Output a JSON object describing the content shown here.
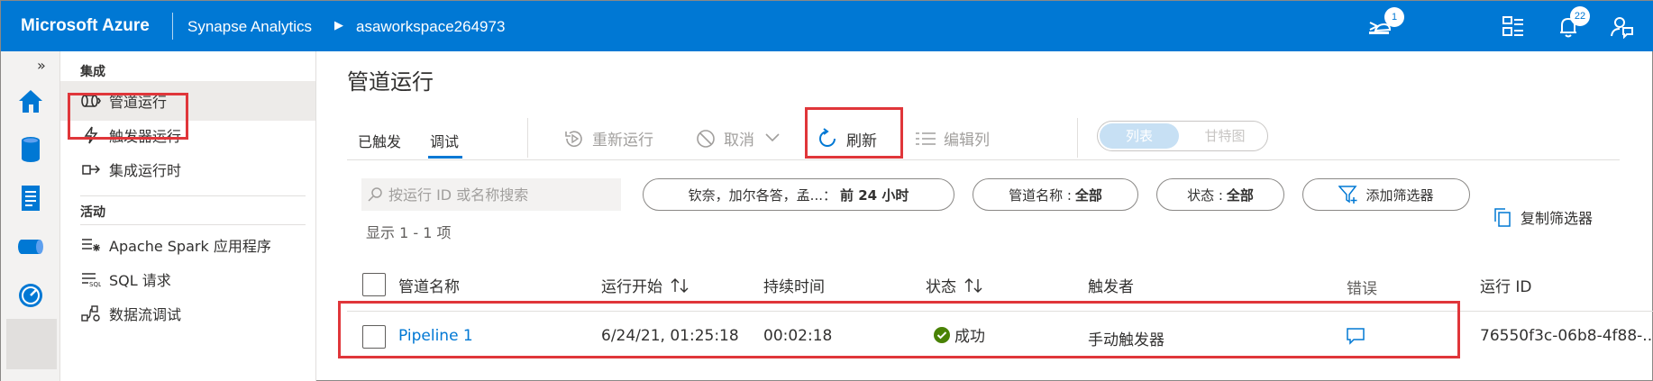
{
  "topbar": {
    "brand": "Microsoft Azure",
    "breadcrumb_service": "Synapse Analytics",
    "breadcrumb_arrow": "▶",
    "breadcrumb_workspace": "asaworkspace264973",
    "notifications_badge_1": "1",
    "notifications_badge_2": "22",
    "icons": [
      "cloud-shell-icon",
      "directory-filter-icon",
      "notifications-icon",
      "feedback-icon"
    ]
  },
  "rail": {
    "expand_glyph": "»",
    "icons": [
      "home-icon",
      "data-icon",
      "develop-icon",
      "integrate-icon",
      "monitor-icon"
    ]
  },
  "nav": {
    "section_integration": "集成",
    "items_integration": [
      {
        "label": "管道运行",
        "icon": "pipeline-runs-icon",
        "selected": true
      },
      {
        "label": "触发器运行",
        "icon": "trigger-runs-icon",
        "selected": false
      },
      {
        "label": "集成运行时",
        "icon": "integration-runtimes-icon",
        "selected": false
      }
    ],
    "section_activities": "活动",
    "items_activities": [
      {
        "label": "Apache Spark 应用程序",
        "icon": "spark-apps-icon"
      },
      {
        "label": "SQL 请求",
        "icon": "sql-requests-icon"
      },
      {
        "label": "数据流调试",
        "icon": "data-flow-debug-icon"
      }
    ]
  },
  "main": {
    "title": "管道运行",
    "tabs": [
      "已触发",
      "调试"
    ],
    "toolbar": {
      "rerun": "重新运行",
      "cancel": "取消",
      "refresh": "刷新",
      "edit_columns": "编辑列"
    },
    "view_toggle": {
      "list": "列表",
      "gantt": "甘特图",
      "selected": "列表"
    },
    "search_placeholder": "按运行 ID 或名称搜索",
    "filters": {
      "timezone": "钦奈，加尔各答，孟...",
      "time_range_sep": "：",
      "time_range": "前 24 小时",
      "pipeline_name_label": "管道名称 :",
      "pipeline_name_value": "全部",
      "status_label": "状态 :",
      "status_value": "全部",
      "add_filter": "添加筛选器",
      "copy_filter": "复制筛选器"
    },
    "count_text": "显示 1 - 1 项",
    "columns": [
      "管道名称",
      "运行开始",
      "持续时间",
      "状态",
      "触发者",
      "错误",
      "运行 ID"
    ],
    "rows": [
      {
        "pipeline_name": "Pipeline 1",
        "run_start": "6/24/21, 01:25:18",
        "duration": "00:02:18",
        "status": "成功",
        "triggered_by": "手动触发器",
        "run_id": "76550f3c-06b8-4f88-..."
      }
    ]
  },
  "colors": {
    "topbar": "#0078d4",
    "highlight_box": "#e0363a",
    "success": "#498205",
    "link": "#0078d4"
  }
}
